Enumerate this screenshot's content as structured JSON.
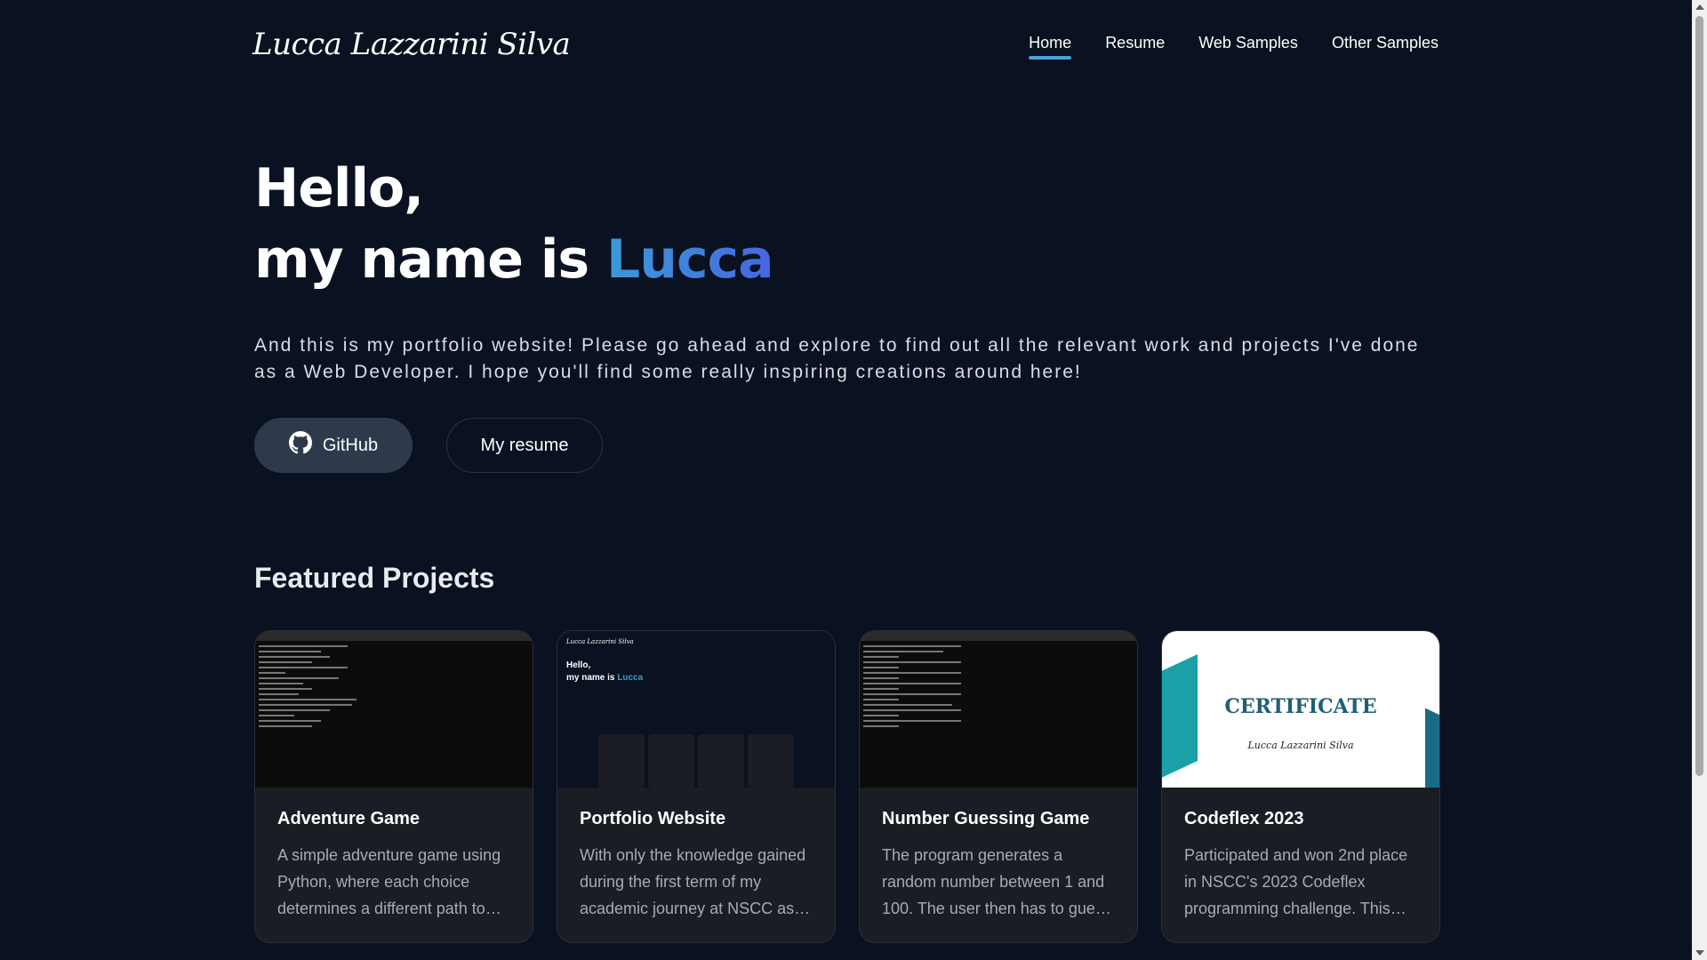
{
  "header": {
    "logo": "Lucca Lazzarini Silva",
    "nav": [
      {
        "label": "Home",
        "active": true
      },
      {
        "label": "Resume",
        "active": false
      },
      {
        "label": "Web Samples",
        "active": false
      },
      {
        "label": "Other Samples",
        "active": false
      }
    ]
  },
  "hero": {
    "line1": "Hello,",
    "line2_prefix": "my name is ",
    "line2_name": "Lucca",
    "intro": "And this is my portfolio website! Please go ahead and explore to find out all the relevant work and projects I've done as a Web Developer. I hope you'll find some really inspiring creations around here!",
    "github_label": "GitHub",
    "resume_label": "My resume"
  },
  "featured": {
    "title": "Featured Projects",
    "cards": [
      {
        "title": "Adventure Game",
        "desc": "A simple adventure game using Python, where each choice determines a different path to reach the end of the story."
      },
      {
        "title": "Portfolio Website",
        "desc": "With only the knowledge gained during the first term of my academic journey at NSCC as a web developer."
      },
      {
        "title": "Number Guessing Game",
        "desc": "The program generates a random number between 1 and 100. The user then has to guess the number."
      },
      {
        "title": "Codeflex 2023",
        "desc": "Participated and won 2nd place in NSCC's 2023 Codeflex programming challenge. This certificate recognizes it."
      }
    ],
    "cert_title": "CERTIFICATE",
    "cert_name": "Lucca Lazzarini Silva"
  },
  "colors": {
    "background": "#0a1120",
    "accent_blue": "#3a9bd8",
    "card_bg": "#1a1d23",
    "github_btn": "#2e3a4c"
  }
}
